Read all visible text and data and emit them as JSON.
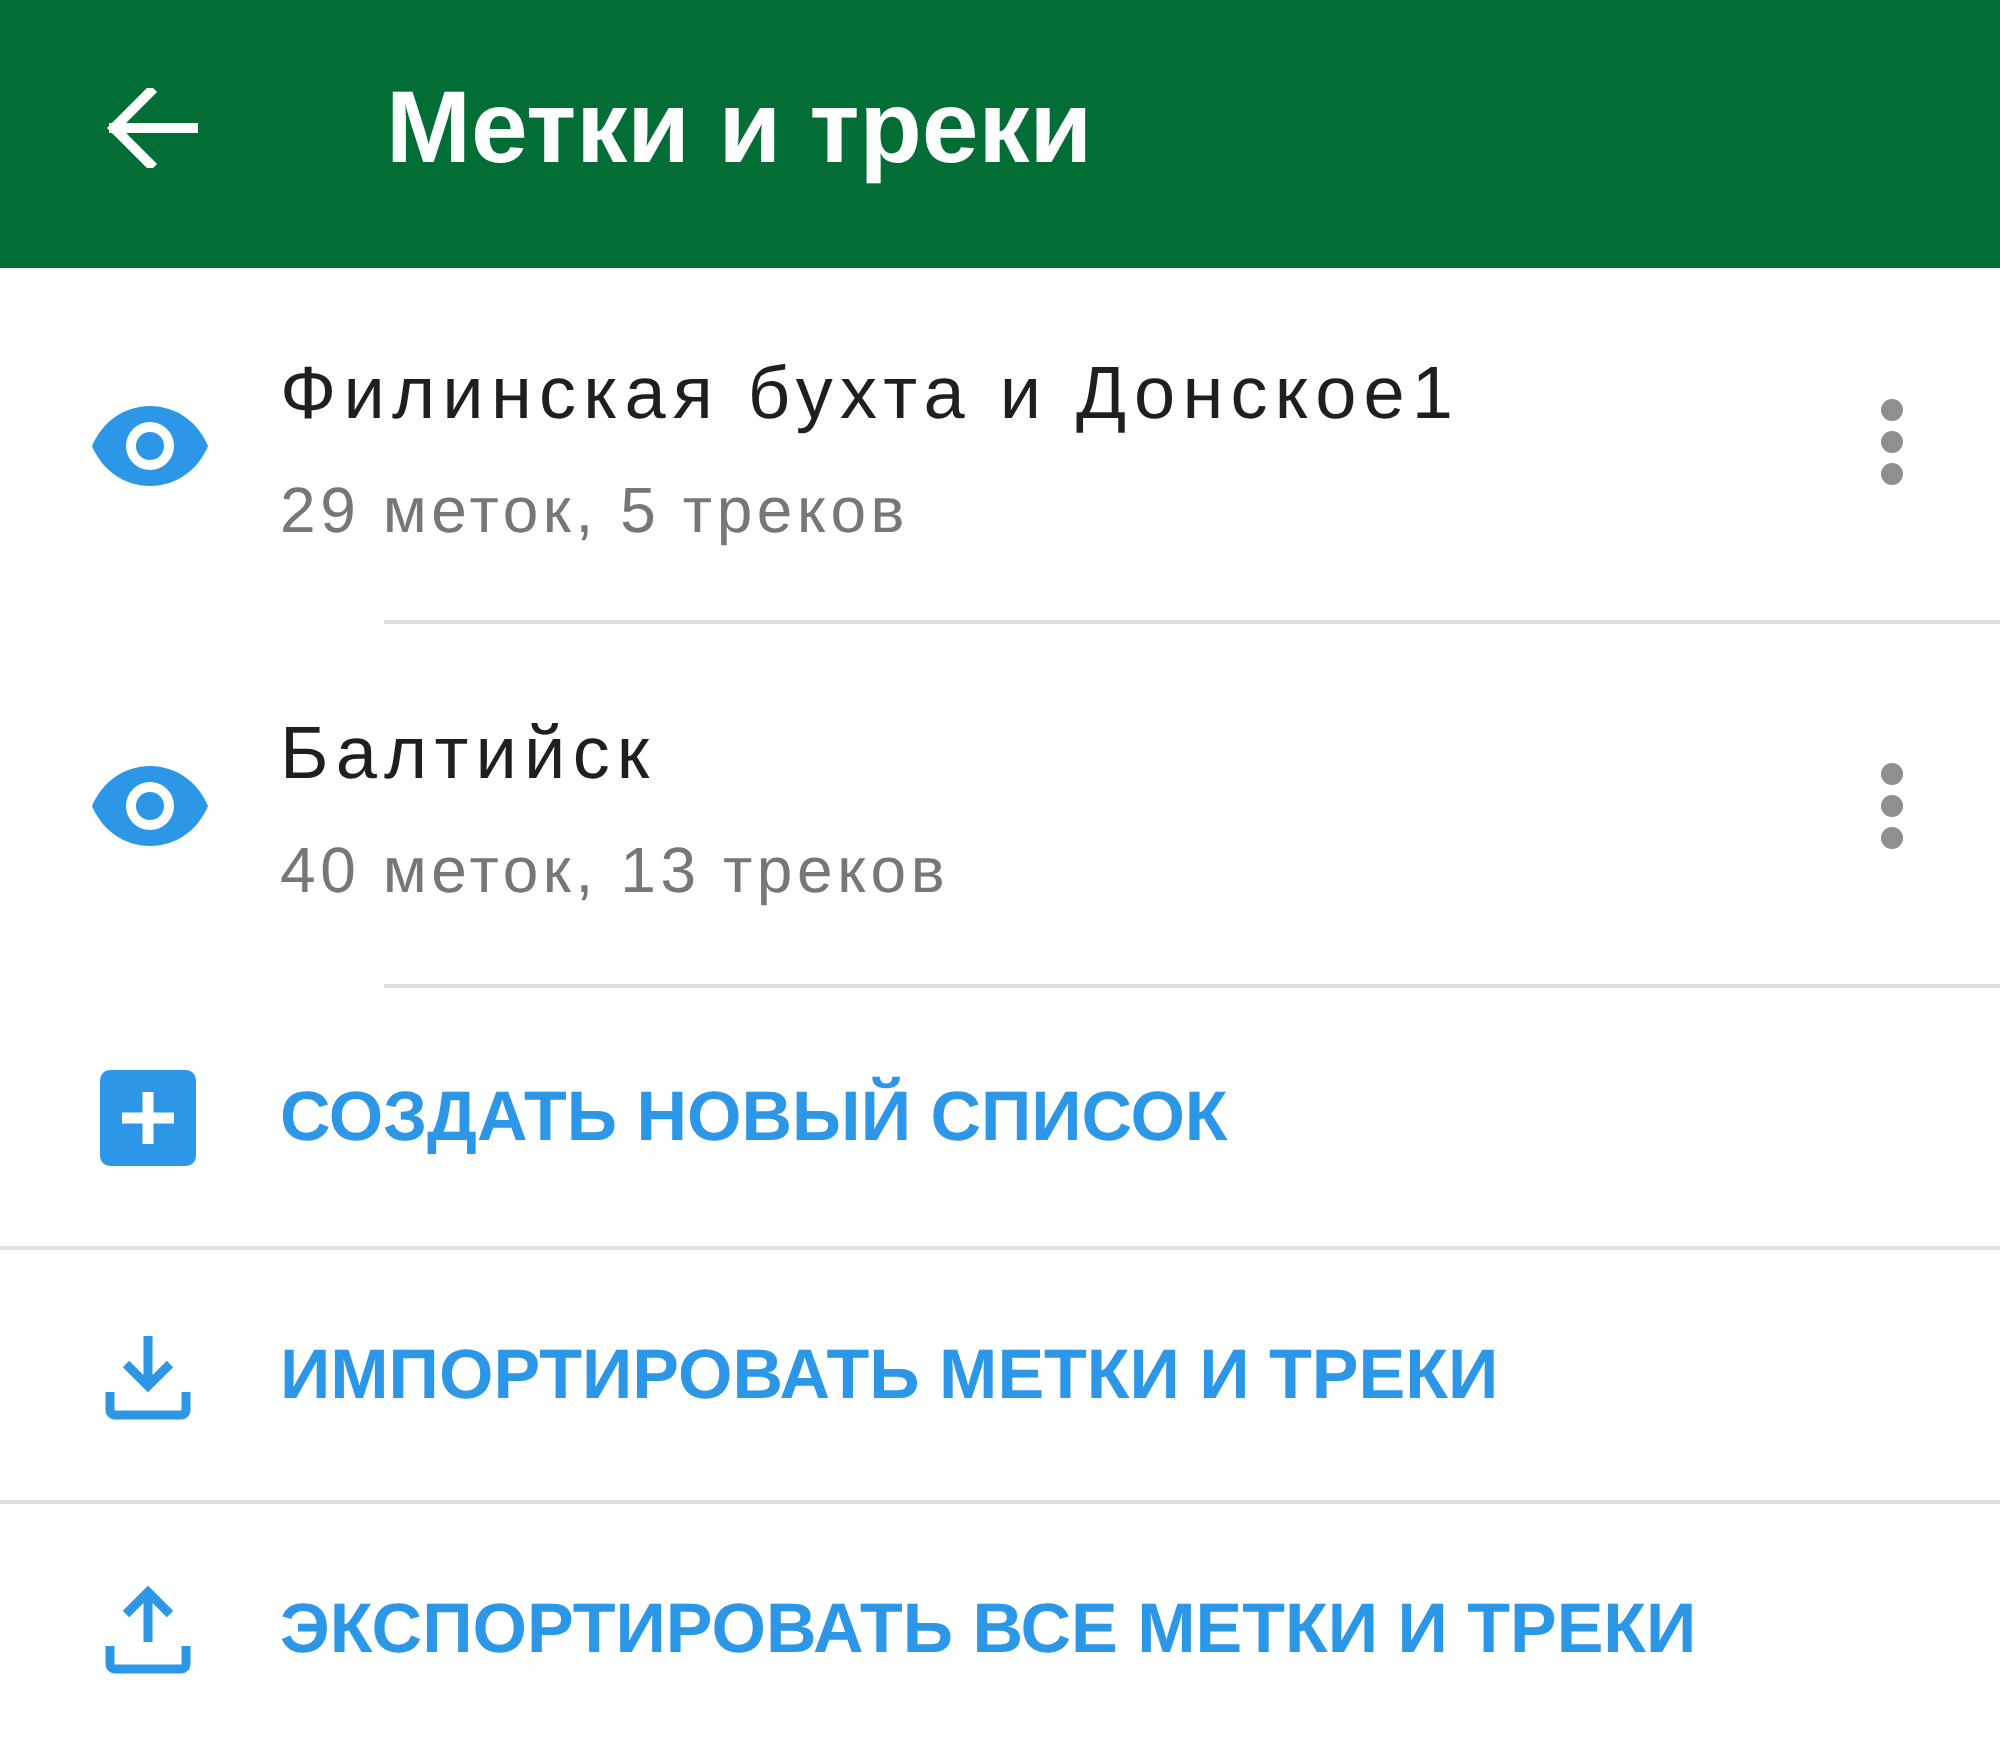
{
  "app_bar": {
    "title": "Метки и треки"
  },
  "lists": [
    {
      "name": "Филинская бухта и Донское1",
      "summary": "29 меток, 5 треков",
      "visible": true
    },
    {
      "name": "Балтийск",
      "summary": "40 меток, 13 треков",
      "visible": true
    }
  ],
  "actions": [
    {
      "kind": "create",
      "label": "СОЗДАТЬ НОВЫЙ СПИСОК"
    },
    {
      "kind": "import",
      "label": "ИМПОРТИРОВАТЬ МЕТКИ И ТРЕКИ"
    },
    {
      "kind": "export",
      "label": "ЭКСПОРТИРОВАТЬ ВСЕ МЕТКИ И ТРЕКИ"
    }
  ]
}
